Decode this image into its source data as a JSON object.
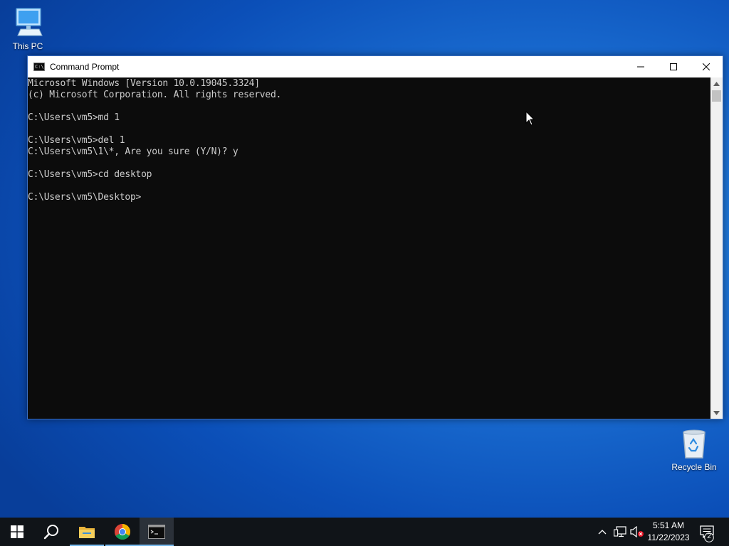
{
  "desktop": {
    "icons": [
      {
        "label": "This PC",
        "icon": "computer-icon"
      },
      {
        "label": "Recycle Bin",
        "icon": "recycle-bin-icon"
      }
    ]
  },
  "window": {
    "title": "Command Prompt",
    "icon": "cmd-icon",
    "controls": [
      "minimize-icon",
      "maximize-icon",
      "close-icon"
    ],
    "console_lines": [
      "Microsoft Windows [Version 10.0.19045.3324]",
      "(c) Microsoft Corporation. All rights reserved.",
      "",
      "C:\\Users\\vm5>md 1",
      "",
      "C:\\Users\\vm5>del 1",
      "C:\\Users\\vm5\\1\\*, Are you sure (Y/N)? y",
      "",
      "C:\\Users\\vm5>cd desktop",
      "",
      "C:\\Users\\vm5\\Desktop>"
    ],
    "colors": {
      "console_bg": "#0c0c0c",
      "console_fg": "#cccccc",
      "titlebar_bg": "#ffffff"
    }
  },
  "taskbar": {
    "items": [
      {
        "name": "start",
        "icon": "windows-logo-icon"
      },
      {
        "name": "search",
        "icon": "search-icon"
      },
      {
        "name": "file-explorer",
        "icon": "folder-icon"
      },
      {
        "name": "chrome",
        "icon": "chrome-icon"
      },
      {
        "name": "command-prompt",
        "icon": "cmd-icon",
        "active": true
      }
    ],
    "tray": {
      "icons": [
        "chevron-up-icon",
        "network-icon",
        "volume-muted-icon"
      ],
      "time": "5:51 AM",
      "date": "11/22/2023",
      "notification_count": "2"
    },
    "colors": {
      "bg": "#101418",
      "active_underline": "#76b9ed"
    }
  }
}
